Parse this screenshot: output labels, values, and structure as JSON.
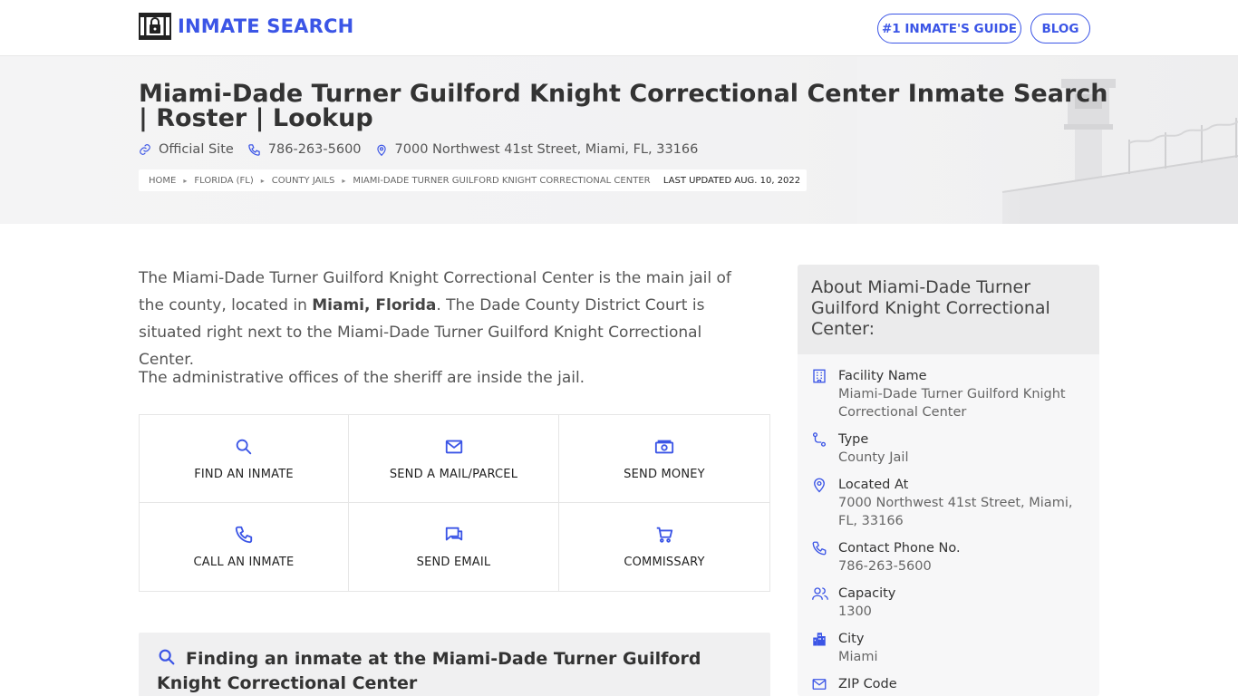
{
  "header": {
    "logo_text": "INMATE SEARCH",
    "nav": {
      "guide": "#1 INMATE'S GUIDE",
      "blog": "BLOG"
    },
    "accent": "#3b55e6"
  },
  "hero": {
    "title": "Miami-Dade Turner Guilford Knight Correctional Center Inmate Search | Roster | Lookup",
    "official_site": "Official Site",
    "phone": "786-263-5600",
    "address": "7000 Northwest 41st Street, Miami, FL, 33166",
    "breadcrumbs": [
      "HOME",
      "FLORIDA (FL)",
      "COUNTY JAILS",
      "MIAMI-DADE TURNER GUILFORD KNIGHT CORRECTIONAL CENTER"
    ],
    "last_updated": "LAST UPDATED AUG. 10, 2022"
  },
  "intro": {
    "p1_a": "The Miami-Dade Turner Guilford Knight Correctional Center is the main jail of the county, located in ",
    "p1_bold": "Miami, Florida",
    "p1_b": ". The Dade County District Court is situated right next to the Miami-Dade Turner Guilford Knight Correctional Center.",
    "p2": "The administrative offices of the sheriff are inside the jail."
  },
  "actions": [
    {
      "label": "FIND AN INMATE",
      "icon": "search-icon"
    },
    {
      "label": "SEND A MAIL/PARCEL",
      "icon": "mail-icon"
    },
    {
      "label": "SEND MONEY",
      "icon": "money-icon"
    },
    {
      "label": "CALL AN INMATE",
      "icon": "phone-icon"
    },
    {
      "label": "SEND EMAIL",
      "icon": "chat-icon"
    },
    {
      "label": "COMMISSARY",
      "icon": "cart-icon"
    }
  ],
  "finding": {
    "title": "Finding an inmate at the Miami-Dade Turner Guilford Knight Correctional Center"
  },
  "sidebar": {
    "heading": "About Miami-Dade Turner Guilford Knight Correctional Center:",
    "items": [
      {
        "label": "Facility Name",
        "value": "Miami-Dade Turner Guilford Knight Correctional Center",
        "icon": "building-icon"
      },
      {
        "label": "Type",
        "value": "County Jail",
        "icon": "route-icon"
      },
      {
        "label": "Located At",
        "value": "7000 Northwest 41st Street, Miami, FL, 33166",
        "icon": "map-pin-icon"
      },
      {
        "label": "Contact Phone No.",
        "value": "786-263-5600",
        "icon": "phone-icon"
      },
      {
        "label": "Capacity",
        "value": "1300",
        "icon": "users-icon"
      },
      {
        "label": "City",
        "value": "Miami",
        "icon": "city-icon"
      },
      {
        "label": "ZIP Code",
        "value": "",
        "icon": "mail-icon"
      }
    ]
  }
}
